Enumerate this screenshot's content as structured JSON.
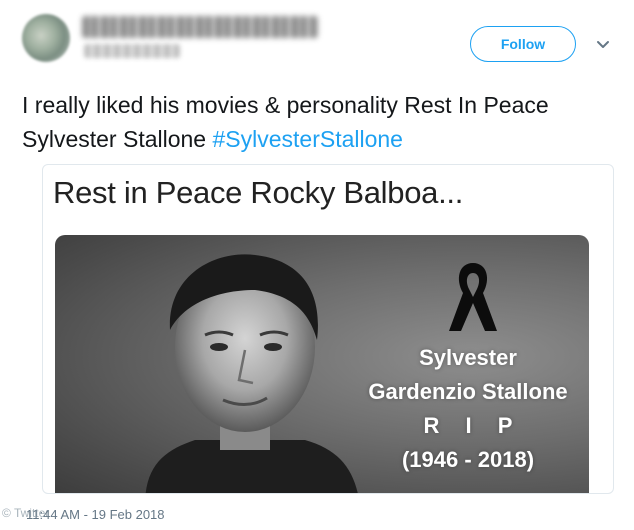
{
  "header": {
    "follow_label": "Follow"
  },
  "tweet": {
    "text": "I really liked his movies & personality Rest In Peace Sylvester Stallone",
    "hashtag": "#SylvesterStallone",
    "timestamp": "11:44 AM - 19 Feb 2018"
  },
  "card": {
    "title": "Rest in Peace Rocky Balboa...",
    "overlay_lines": [
      "Sylvester",
      "Gardenzio Stallone",
      "R I P",
      "(1946 - 2018)"
    ]
  },
  "watermark": "© Twitter",
  "icons": {
    "caret": "chevron-down-icon",
    "ribbon": "mourning-ribbon-icon"
  },
  "colors": {
    "accent": "#1da1f2",
    "text": "#14171a",
    "muted": "#657786"
  }
}
